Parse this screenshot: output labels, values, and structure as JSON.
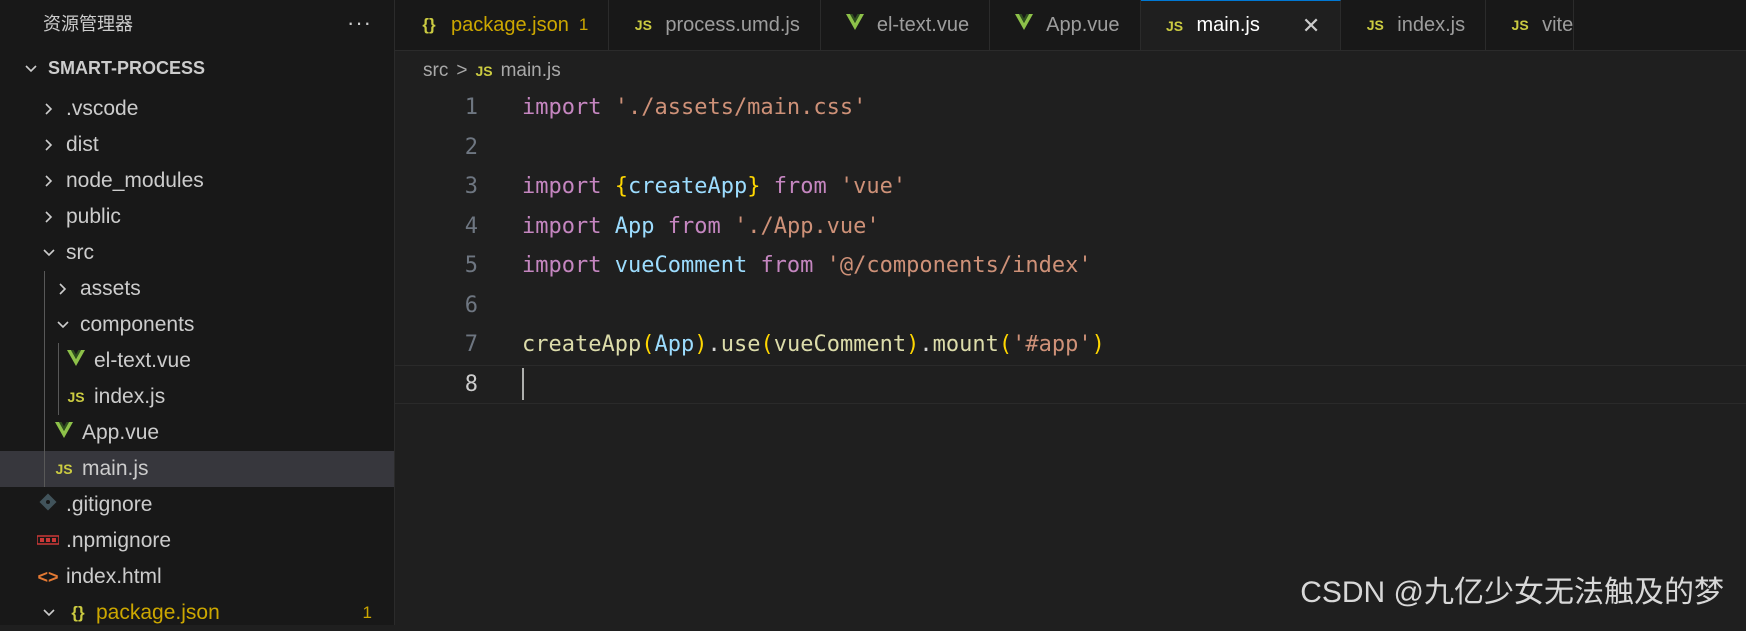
{
  "sidebar": {
    "header_title": "资源管理器",
    "more_label": "···",
    "root_label": "SMART-PROCESS",
    "items": [
      {
        "label": ".vscode"
      },
      {
        "label": "dist"
      },
      {
        "label": "node_modules"
      },
      {
        "label": "public"
      },
      {
        "label": "src"
      },
      {
        "label": "assets"
      },
      {
        "label": "components"
      },
      {
        "label": "el-text.vue"
      },
      {
        "label": "index.js"
      },
      {
        "label": "App.vue"
      },
      {
        "label": "main.js"
      },
      {
        "label": ".gitignore"
      },
      {
        "label": ".npmignore"
      },
      {
        "label": "index.html"
      },
      {
        "label": "package.json",
        "badge": "1"
      }
    ]
  },
  "tabs": [
    {
      "label": "package.json",
      "icon": "json-icon",
      "badge": "1"
    },
    {
      "label": "process.umd.js",
      "icon": "js-icon"
    },
    {
      "label": "el-text.vue",
      "icon": "vue-icon"
    },
    {
      "label": "App.vue",
      "icon": "vue-icon"
    },
    {
      "label": "main.js",
      "icon": "js-icon",
      "active": true,
      "close": "✕"
    },
    {
      "label": "index.js",
      "icon": "js-icon"
    },
    {
      "label": "vite",
      "icon": "js-icon"
    }
  ],
  "icons": {
    "js": "JS",
    "json": "{}",
    "html": "<>"
  },
  "breadcrumb": {
    "folder": "src",
    "sep": ">",
    "file": "main.js"
  },
  "editor": {
    "line_numbers": [
      "1",
      "2",
      "3",
      "4",
      "5",
      "6",
      "7",
      "8"
    ],
    "code": {
      "l1": {
        "kw": "import",
        "path": "'./assets/main.css'"
      },
      "l3": {
        "kw": "import",
        "open": "{",
        "name": "createApp",
        "close": "}",
        "from": "from",
        "src": "'vue'"
      },
      "l4": {
        "kw": "import",
        "name": "App",
        "from": "from",
        "src": "'./App.vue'"
      },
      "l5": {
        "kw": "import",
        "name": "vueComment",
        "from": "from",
        "src": "'@/components/index'"
      },
      "l7": {
        "fn1": "createApp",
        "p1o": "(",
        "arg1": "App",
        "p1c": ")",
        "dot1": ".",
        "fn2": "use",
        "p2o": "(",
        "arg2": "vueComment",
        "p2c": ")",
        "dot2": ".",
        "fn3": "mount",
        "p3o": "(",
        "arg3": "'#app'",
        "p3c": ")"
      }
    }
  },
  "watermark": "CSDN @九亿少女无法触及的梦"
}
